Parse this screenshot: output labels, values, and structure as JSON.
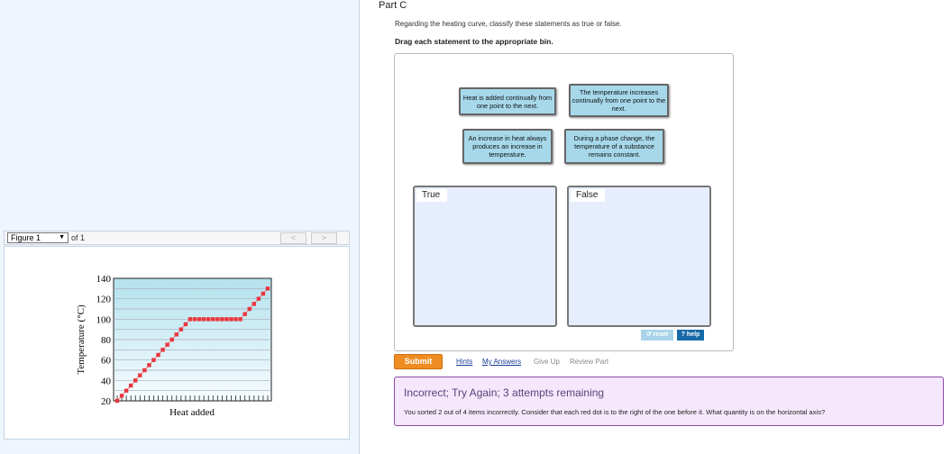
{
  "figure": {
    "selector": "Figure 1",
    "of": "of 1",
    "prev": "<",
    "next": ">"
  },
  "part": {
    "title": "Part C",
    "instruction": "Regarding the heating curve, classify these statements as true or false.",
    "drag_instruction": "Drag each statement to the appropriate bin."
  },
  "cards": [
    "Heat is added continually from one point to the next.",
    "The temperature increases continually from one point to the next.",
    "An increase in heat always produces an increase in temperature.",
    "During a phase change, the temperature of a substance remains constant."
  ],
  "bins": {
    "true_label": "True",
    "false_label": "False"
  },
  "controls": {
    "reset": "↺ reset",
    "help": "? help",
    "submit": "Submit",
    "hints": "Hints",
    "my_answers": "My Answers",
    "give_up": "Give Up",
    "review_part": "Review Part"
  },
  "feedback": {
    "title": "Incorrect; Try Again; 3 attempts remaining",
    "message": "You sorted 2 out of 4 items incorrectly. Consider that each red dot is to the right of the one before it. What quantity is on the horizontal axis?"
  },
  "chart_data": {
    "type": "scatter",
    "title": "",
    "xlabel": "Heat added",
    "ylabel": "Temperature (°C)",
    "ylim": [
      20,
      140
    ],
    "yticks": [
      20,
      40,
      60,
      80,
      100,
      120,
      140
    ],
    "values": [
      20,
      25,
      30,
      35,
      40,
      45,
      50,
      55,
      60,
      65,
      70,
      75,
      80,
      85,
      90,
      95,
      100,
      100,
      100,
      100,
      100,
      100,
      100,
      100,
      100,
      100,
      100,
      100,
      105,
      110,
      115,
      120,
      125,
      130
    ],
    "point_color": "#e8353d"
  }
}
